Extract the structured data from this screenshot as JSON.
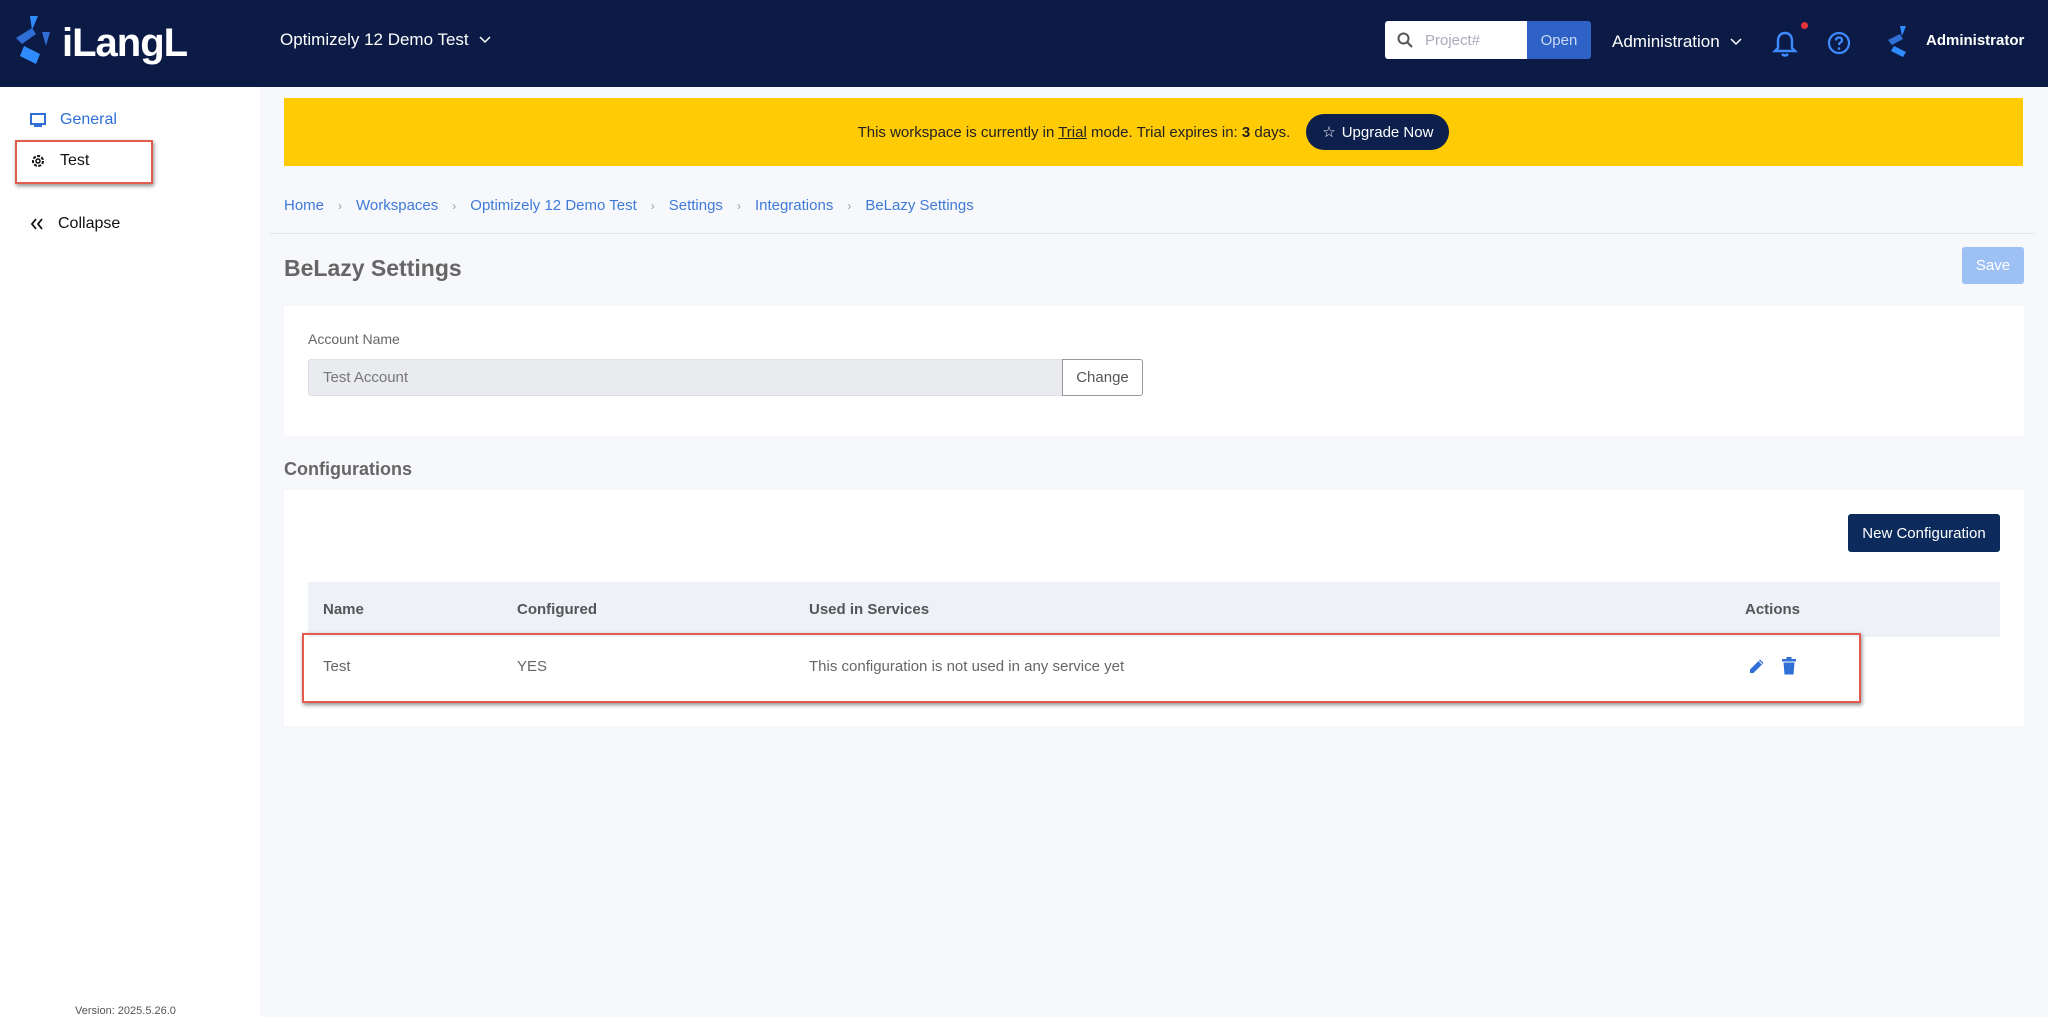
{
  "topbar": {
    "logo_text": "iLangL",
    "workspace_name": "Optimizely 12 Demo Test",
    "search_placeholder": "Project#",
    "open_label": "Open",
    "admin_menu_label": "Administration",
    "user_name": "Administrator"
  },
  "sidebar": {
    "items": [
      {
        "label": "General",
        "icon": "monitor-icon"
      },
      {
        "label": "Test",
        "icon": "gear-icon"
      },
      {
        "label": "Collapse",
        "icon": "double-chevron-left-icon"
      }
    ],
    "version": "Version: 2025.5.26.0"
  },
  "banner": {
    "text_prefix": "This workspace is currently in",
    "trial_word": "Trial",
    "text_mid": "mode. Trial expires in:",
    "days_number": "3",
    "text_suffix": "days.",
    "upgrade_label": "Upgrade Now"
  },
  "breadcrumb": [
    "Home",
    "Workspaces",
    "Optimizely 12 Demo Test",
    "Settings",
    "Integrations",
    "BeLazy Settings"
  ],
  "page": {
    "title": "BeLazy Settings",
    "save_label": "Save"
  },
  "account": {
    "label": "Account Name",
    "value": "Test Account",
    "change_label": "Change"
  },
  "configurations": {
    "title": "Configurations",
    "new_label": "New Configuration",
    "columns": [
      "Name",
      "Configured",
      "Used in Services",
      "Actions"
    ],
    "rows": [
      {
        "name": "Test",
        "configured": "YES",
        "used": "This configuration is not used in any service yet"
      }
    ]
  },
  "colors": {
    "navy": "#0b1b46",
    "accent_blue": "#2f6fd6",
    "banner_yellow": "#ffcb05",
    "highlight_red": "#e25c4d"
  }
}
